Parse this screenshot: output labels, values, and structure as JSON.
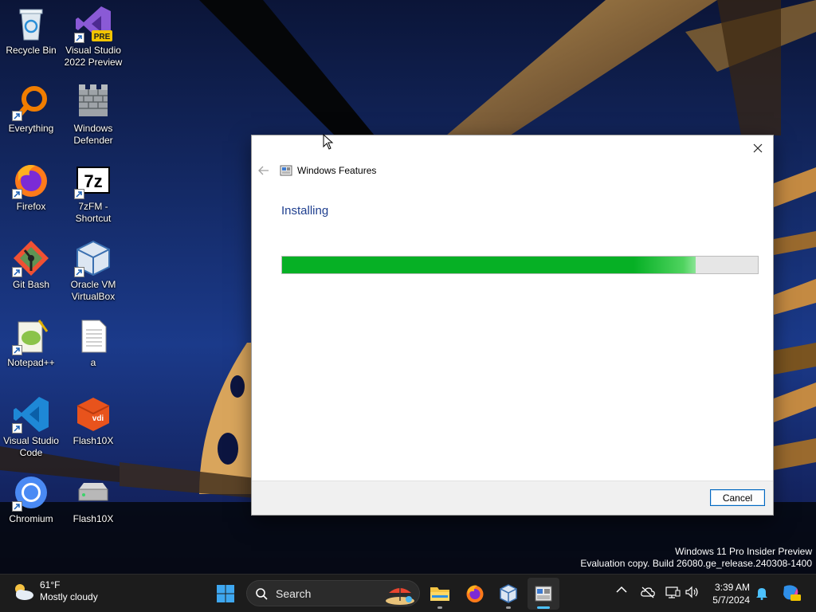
{
  "desktop": {
    "icons": [
      {
        "label": "Recycle Bin",
        "icon": "recycle-bin-icon"
      },
      {
        "label": "Visual Studio 2022 Preview",
        "icon": "visual-studio-preview-icon",
        "badge": "PRE"
      },
      {
        "label": "Everything",
        "icon": "everything-search-icon"
      },
      {
        "label": "Windows Defender",
        "icon": "windows-defender-icon"
      },
      {
        "label": "Firefox",
        "icon": "firefox-icon"
      },
      {
        "label": "7zFM - Shortcut",
        "icon": "7zip-icon",
        "glyph": "7z"
      },
      {
        "label": "Git Bash",
        "icon": "git-bash-icon"
      },
      {
        "label": "Oracle VM VirtualBox",
        "icon": "virtualbox-icon"
      },
      {
        "label": "Notepad++",
        "icon": "notepad-plus-plus-icon"
      },
      {
        "label": "a",
        "icon": "text-file-icon"
      },
      {
        "label": "Visual Studio Code",
        "icon": "vscode-icon"
      },
      {
        "label": "Flash10X",
        "icon": "flash10x-vdi-icon",
        "glyph": "vdi"
      },
      {
        "label": "Chromium",
        "icon": "chromium-icon"
      },
      {
        "label": "Flash10X",
        "icon": "flash10x-drive-icon"
      }
    ]
  },
  "dialog": {
    "title": "Windows Features",
    "heading": "Installing",
    "progress": 0.87,
    "cancel_label": "Cancel",
    "accent_color": "#06b025"
  },
  "watermark": {
    "line1": "Windows 11 Pro Insider Preview",
    "line2": "Evaluation copy. Build 26080.ge_release.240308-1400"
  },
  "taskbar": {
    "weather": {
      "temp": "61°F",
      "condition": "Mostly cloudy"
    },
    "search_placeholder": "Search",
    "apps": [
      "start-icon",
      "file-explorer-icon",
      "firefox-icon",
      "virtualbox-icon",
      "windows-features-icon"
    ],
    "clock": {
      "time": "3:39 AM",
      "date": "5/7/2024"
    }
  }
}
